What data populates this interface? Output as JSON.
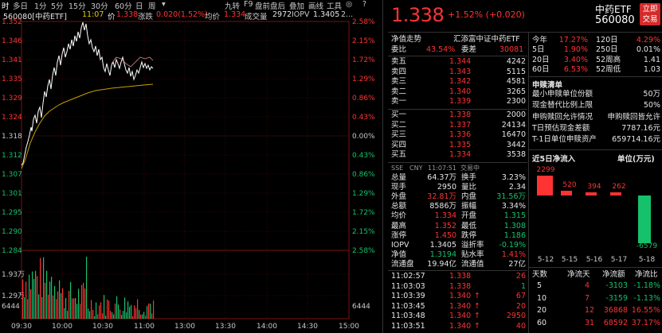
{
  "toolbar": {
    "tabs": [
      "时",
      "多日",
      "1分",
      "5分",
      "15分",
      "30分",
      "60分",
      "日",
      "周",
      "▾"
    ],
    "right_items": [
      "九转",
      "F9",
      "盘前盘后",
      "叠加",
      "画线",
      "工具",
      "◎",
      "?"
    ]
  },
  "infoline": {
    "code_name": "560080[中药ETF]",
    "time": "11:07",
    "price": "1.338",
    "chg_label": "涨跌",
    "chg_value": "0.020(1.52%)",
    "avg_label": "均价",
    "avg_value": "1.334",
    "vol_label": "成交量",
    "vol_value": "2972",
    "iopv_label": "IOPV",
    "iopv_value": "1.3405",
    "more": "2..."
  },
  "chart": {
    "price_axis": [
      "1.352",
      "1.346",
      "1.341",
      "1.335",
      "1.329",
      "1.324",
      "1.318",
      "1.312",
      "1.307",
      "1.301",
      "1.295",
      "1.290",
      "1.284"
    ],
    "pct_axis": [
      "2.58%",
      "2.15%",
      "1.72%",
      "1.29%",
      "0.86%",
      "0.43%",
      "0.00%",
      "0.43%",
      "0.86%",
      "1.29%",
      "1.72%",
      "2.15%",
      "2.58%"
    ],
    "vol_axis": [
      "1.93万",
      "1.29万",
      "6444"
    ],
    "vol_axis_right": "6444",
    "time_axis": [
      "09:30",
      "10:00",
      "10:30",
      "11:00",
      "13:00",
      "13:30",
      "14:00",
      "14:30",
      "15:00"
    ],
    "colors": {
      "price_line": "#ffffff",
      "avg_line": "#e6c800",
      "up": "#ff3333",
      "down": "#16c16c",
      "grid": "#7a1515"
    }
  },
  "quote": {
    "price": "1.338",
    "change": "+1.52% (+0.020)",
    "name": "中药ETF",
    "code": "560080",
    "trade_button": [
      "立即",
      "交易"
    ],
    "trend_label": "净值走势",
    "index_name": "汇添富中证中药ETF",
    "weibi_label": "委比",
    "weibi_value": "43.54%",
    "weicha_label": "委差",
    "weicha_value": "30081"
  },
  "asks": [
    {
      "label": "卖五",
      "price": "1.344",
      "vol": "4242"
    },
    {
      "label": "卖四",
      "price": "1.343",
      "vol": "5115"
    },
    {
      "label": "卖三",
      "price": "1.342",
      "vol": "4581"
    },
    {
      "label": "卖二",
      "price": "1.340",
      "vol": "3265"
    },
    {
      "label": "卖一",
      "price": "1.339",
      "vol": "2300"
    }
  ],
  "bids": [
    {
      "label": "买一",
      "price": "1.338",
      "vol": "2000"
    },
    {
      "label": "买二",
      "price": "1.337",
      "vol": "24134"
    },
    {
      "label": "买三",
      "price": "1.336",
      "vol": "16470"
    },
    {
      "label": "买四",
      "price": "1.335",
      "vol": "3442"
    },
    {
      "label": "买五",
      "price": "1.334",
      "vol": "3538"
    }
  ],
  "stats": [
    {
      "l1": "总量",
      "v1": "64.37万",
      "c1": "white",
      "l2": "换手",
      "v2": "3.23%",
      "c2": "white"
    },
    {
      "l1": "现手",
      "v1": "2950",
      "c1": "white",
      "l2": "量比",
      "v2": "2.34",
      "c2": "white"
    },
    {
      "l1": "外盘",
      "v1": "32.81万",
      "c1": "red",
      "l2": "内盘",
      "v2": "31.56万",
      "c2": "green"
    },
    {
      "l1": "总额",
      "v1": "8586万",
      "c1": "white",
      "l2": "振幅",
      "v2": "3.34%",
      "c2": "white"
    },
    {
      "l1": "均价",
      "v1": "1.334",
      "c1": "red",
      "l2": "开盘",
      "v2": "1.315",
      "c2": "green"
    },
    {
      "l1": "最高",
      "v1": "1.352",
      "c1": "red",
      "l2": "最低",
      "v2": "1.308",
      "c2": "green"
    },
    {
      "l1": "涨停",
      "v1": "1.450",
      "c1": "red",
      "l2": "跌停",
      "v2": "1.186",
      "c2": "green"
    },
    {
      "l1": "IOPV",
      "v1": "1.3405",
      "c1": "white",
      "l2": "溢折率",
      "v2": "-0.19%",
      "c2": "green"
    },
    {
      "l1": "净值",
      "v1": "1.3194",
      "c1": "green",
      "l2": "贴水率",
      "v2": "1.41%",
      "c2": "red"
    },
    {
      "l1": "流通盘",
      "v1": "19.94亿",
      "c1": "white",
      "l2": "流通值",
      "v2": "27亿",
      "c2": "white"
    }
  ],
  "ticks": [
    {
      "time": "11:02:57",
      "price": "1.338",
      "arrow": "",
      "vol": "26",
      "vc": "red"
    },
    {
      "time": "11:03:03",
      "price": "1.338",
      "arrow": "",
      "vol": "1",
      "vc": "green"
    },
    {
      "time": "11:03:39",
      "price": "1.340",
      "arrow": "↑",
      "vol": "67",
      "vc": "red"
    },
    {
      "time": "11:03:45",
      "price": "1.340",
      "arrow": "↑",
      "vol": "20",
      "vc": "red"
    },
    {
      "time": "11:03:48",
      "price": "1.340",
      "arrow": "↑",
      "vol": "2950",
      "vc": "red"
    },
    {
      "time": "11:03:51",
      "price": "1.340",
      "arrow": "↑",
      "vol": "40",
      "vc": "red"
    }
  ],
  "snapshot": {
    "market": "SSE",
    "currency": "CNY",
    "time": "11:07:51",
    "status": "交易中"
  },
  "perf": [
    {
      "l1": "今年",
      "v1": "17.27%",
      "c1": "red",
      "l2": "120日",
      "v2": "4.29%",
      "c2": "red"
    },
    {
      "l1": "5日",
      "v1": "1.90%",
      "c1": "red",
      "l2": "250日",
      "v2": "0.01%",
      "c2": "white"
    },
    {
      "l1": "20日",
      "v1": "3.40%",
      "c1": "red",
      "l2": "52周高",
      "v2": "1.41",
      "c2": "white"
    },
    {
      "l1": "60日",
      "v1": "6.53%",
      "c1": "red",
      "l2": "52周低",
      "v2": "1.03",
      "c2": "white"
    }
  ],
  "subscribe": {
    "title": "申赎清单",
    "rows": [
      {
        "label": "最小申赎单位份额",
        "value": "50万"
      },
      {
        "label": "现金替代比例上限",
        "value": "50%"
      },
      {
        "label": "申购赎回允许情况",
        "value": "申购赎回皆允许"
      },
      {
        "label": "T日预估现金差额",
        "value": "7787.16元"
      },
      {
        "label": "T-1日单位申赎资产",
        "value": "659714.16元"
      }
    ]
  },
  "inflow": {
    "title": "近5日净流入",
    "unit": "单位(万元)",
    "chart_data": {
      "type": "bar",
      "categories": [
        "5-12",
        "5-15",
        "5-16",
        "5-17",
        "5-18"
      ],
      "values": [
        2299,
        520,
        394,
        262,
        -6579
      ],
      "value_labels": [
        "2299",
        "520",
        "394",
        "262",
        "-6579"
      ]
    }
  },
  "flow_table": {
    "headers": [
      "天数",
      "净流天",
      "净流额",
      "净流比"
    ],
    "rows": [
      {
        "days": "5",
        "flowdays": "4",
        "amount": "-3103",
        "ratio": "-1.18%",
        "c": "green"
      },
      {
        "days": "10",
        "flowdays": "7",
        "amount": "-3159",
        "ratio": "-1.13%",
        "c": "green"
      },
      {
        "days": "20",
        "flowdays": "12",
        "amount": "36868",
        "ratio": "16.55%",
        "c": "red"
      },
      {
        "days": "60",
        "flowdays": "31",
        "amount": "68592",
        "ratio": "37.17%",
        "c": "red"
      }
    ]
  }
}
